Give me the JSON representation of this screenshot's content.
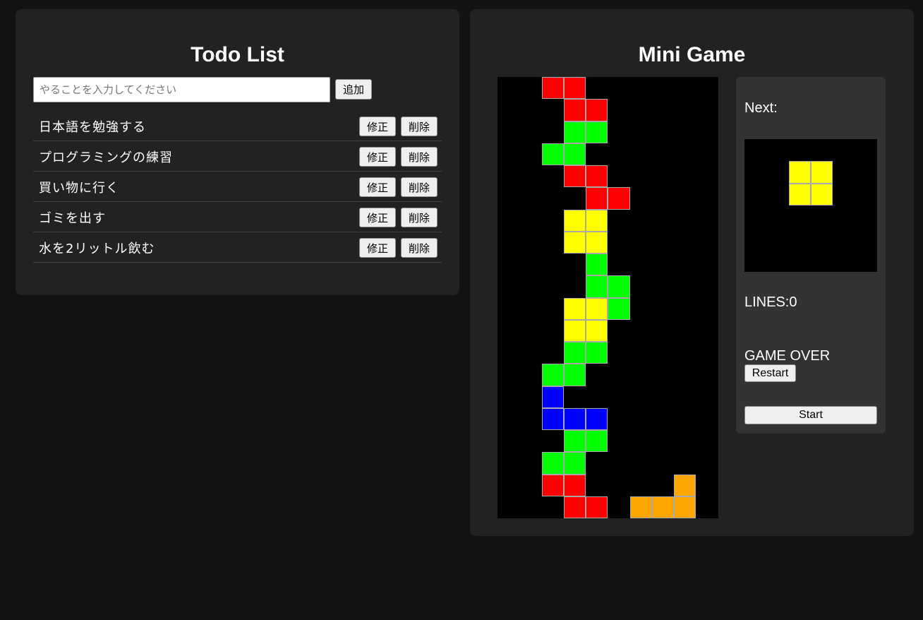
{
  "todo": {
    "title": "Todo List",
    "input_placeholder": "やることを入力してください",
    "input_value": "",
    "add_label": "追加",
    "edit_label": "修正",
    "delete_label": "削除",
    "items": [
      {
        "text": "日本語を勉強する"
      },
      {
        "text": "プログラミングの練習"
      },
      {
        "text": "買い物に行く"
      },
      {
        "text": "ゴミを出す"
      },
      {
        "text": "水を2リットル飲む"
      }
    ]
  },
  "game": {
    "title": "Mini Game",
    "next_label": "Next:",
    "lines_text": "LINES:0",
    "status_text": "GAME OVER",
    "restart_label": "Restart",
    "start_label": "Start",
    "colors": {
      "R": "#ff0000",
      "G": "#00ff00",
      "Y": "#ffff00",
      "B": "#0000ff",
      "O": "#ffa500"
    },
    "board_rows": [
      "..RR......",
      "...RR.....",
      "...GG.....",
      "..GG......",
      "...RR.....",
      "....RR....",
      "...YY.....",
      "...YY.....",
      "....G.....",
      "....GG....",
      "...YYG....",
      "...YY.....",
      "...GG.....",
      "..GG......",
      "..B.......",
      "..BBB.....",
      "...GG.....",
      "..GG......",
      "..RR....O.",
      "...RR.OOO."
    ],
    "next_piece": {
      "rows": [
        "......",
        "..YY..",
        "..YY..",
        "......",
        "......",
        "......"
      ]
    }
  }
}
